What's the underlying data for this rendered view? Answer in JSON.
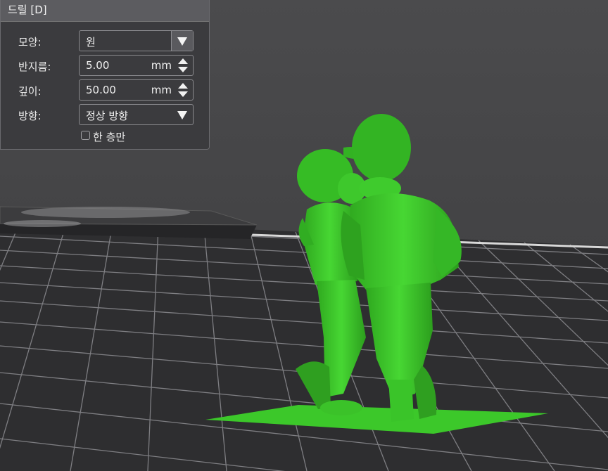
{
  "panel": {
    "title": "드릴 [D]",
    "shape": {
      "label": "모양:",
      "value": "원"
    },
    "radius": {
      "label": "반지름:",
      "value": "5.00",
      "unit": "mm"
    },
    "depth": {
      "label": "깊이:",
      "value": "50.00",
      "unit": "mm"
    },
    "direction": {
      "label": "방향:",
      "value": "정상 방향"
    },
    "one_layer": {
      "label": "한 층만",
      "checked": false
    }
  },
  "colors": {
    "background": "#4a4a4c",
    "model": "#3dcc2a",
    "panel": "#3b3b3e"
  },
  "viewport": {
    "object": "two-figures-model-on-build-plate",
    "icons": [
      "dropdown-arrow-icon",
      "spinner-arrows-icon",
      "checkbox"
    ]
  }
}
